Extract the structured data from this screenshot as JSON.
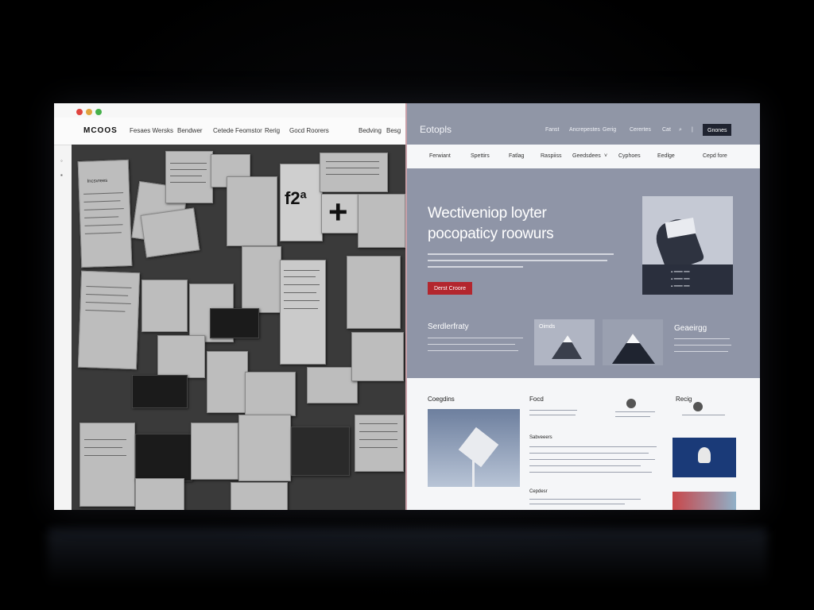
{
  "left_window": {
    "traffic_lights": [
      "#e0443e",
      "#e0a43e",
      "#46b04a"
    ],
    "logo": "MCOOS",
    "nav": [
      "Fesaes Wersks",
      "Bendwer",
      "Cetede Feomstor",
      "Rerig",
      "Gocd Roorers",
      "Bedving",
      "Besg"
    ],
    "collage_text": {
      "big_number": "f2ª",
      "plus": "+",
      "note_title": "Incsvrees"
    }
  },
  "right_window": {
    "brand": "Eotopls",
    "top_links": [
      "Fanst",
      "Ancrepestes",
      "Gerig",
      "Cerertes",
      "Cat"
    ],
    "top_button": "Gnones",
    "nav": [
      "Ferwiant",
      "Spettirs",
      "Fatlag",
      "Raspiiss",
      "Geedsdees",
      "Cyphoes",
      "Eedlge",
      "Cepd fore"
    ],
    "hero": {
      "headline_1": "Wectiveniop loyter",
      "headline_2": "pocopaticy roowurs",
      "cta": "Derst Croore"
    },
    "section_left_title": "Serdlerfraty",
    "tile_1_label": "Oimds",
    "section_right_title": "Geaeirgg",
    "white": {
      "col1_title": "Coegdins",
      "col2_title": "Focd",
      "col3_title": "Recig",
      "sub_title_1": "Sabveeers",
      "sub_title_2": "Cepdesr"
    }
  }
}
